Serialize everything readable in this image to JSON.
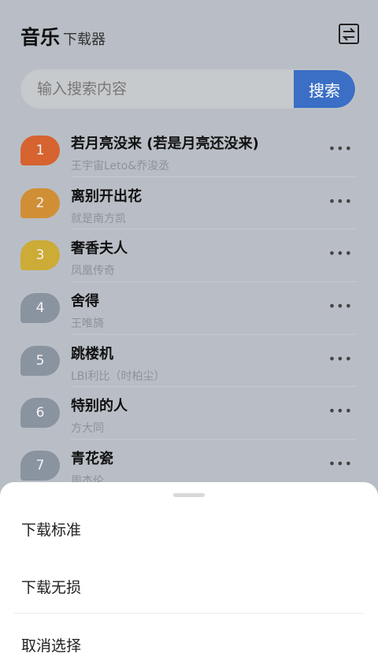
{
  "header": {
    "title": "音乐",
    "subtitle": "下载器",
    "menu_icon": "swap-list-icon"
  },
  "search": {
    "placeholder": "输入搜索内容",
    "button_label": "搜索",
    "accent": "#3b6fc6"
  },
  "songs": [
    {
      "rank": "1",
      "title": "若月亮没来 (若是月亮还没来)",
      "artist": "王宇宙Leto&乔浚丞",
      "color": "#d66330"
    },
    {
      "rank": "2",
      "title": "离别开出花",
      "artist": "就是南方凯",
      "color": "#d08f35"
    },
    {
      "rank": "3",
      "title": "奢香夫人",
      "artist": "凤凰传奇",
      "color": "#ccab37"
    },
    {
      "rank": "4",
      "title": "舍得",
      "artist": "王唯旖",
      "color": "#8a93a0"
    },
    {
      "rank": "5",
      "title": "跳楼机",
      "artist": "LBI利比（时柏尘）",
      "color": "#8a93a0"
    },
    {
      "rank": "6",
      "title": "特别的人",
      "artist": "方大同",
      "color": "#8a93a0"
    },
    {
      "rank": "7",
      "title": "青花瓷",
      "artist": "周杰伦",
      "color": "#8a93a0"
    }
  ],
  "more_label": "•••",
  "sheet": {
    "items": [
      "下载标准",
      "下载无损",
      "取消选择"
    ]
  }
}
